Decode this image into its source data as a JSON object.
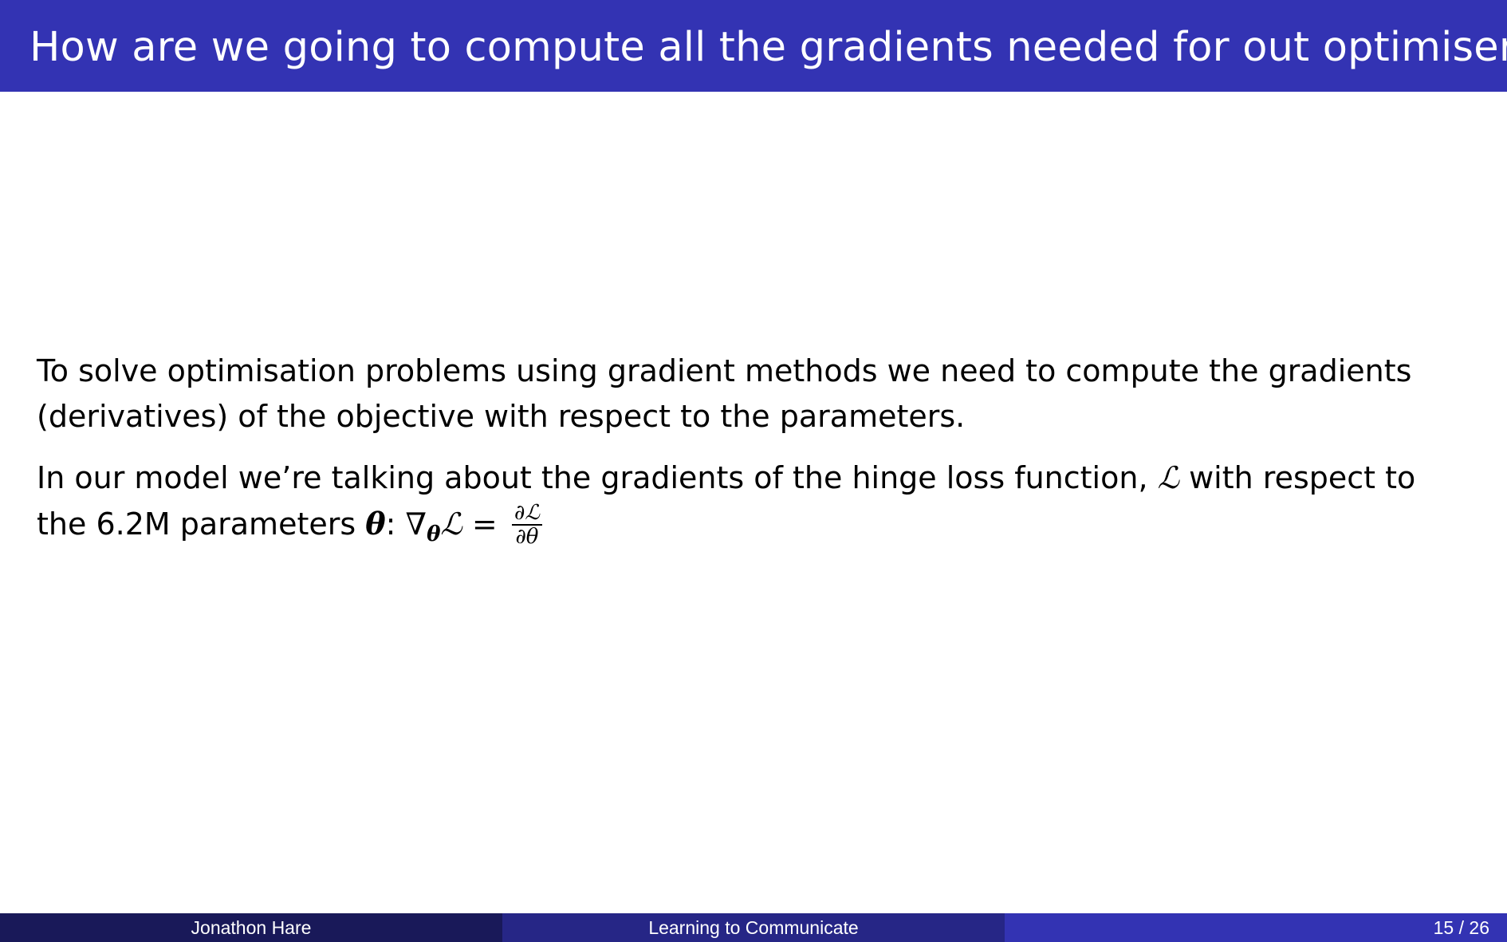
{
  "slide": {
    "title": "How are we going to compute all the gradients needed for out optimiser?",
    "paragraph1": "To solve optimisation problems using gradient methods we need to compute the gradients (derivatives) of the objective with respect to the parameters.",
    "paragraph2": {
      "text_before_L": "In our model we’re talking about the gradients of the hinge loss function,",
      "loss_symbol": "ℒ",
      "text_after_L": "with respect to the 6.2M parameters",
      "theta_symbol": "θ",
      "colon": ":",
      "nabla": "∇",
      "equals": "=",
      "frac_numerator": "∂ℒ",
      "frac_denominator": "∂θ"
    }
  },
  "footer": {
    "author": "Jonathon Hare",
    "talk_title": "Learning to Communicate",
    "page_current": "15",
    "page_separator": "/",
    "page_total": "26"
  },
  "colors": {
    "title_bar": "#3333b3",
    "footer_left": "#191959",
    "footer_middle": "#262686",
    "footer_right": "#3333b3"
  }
}
